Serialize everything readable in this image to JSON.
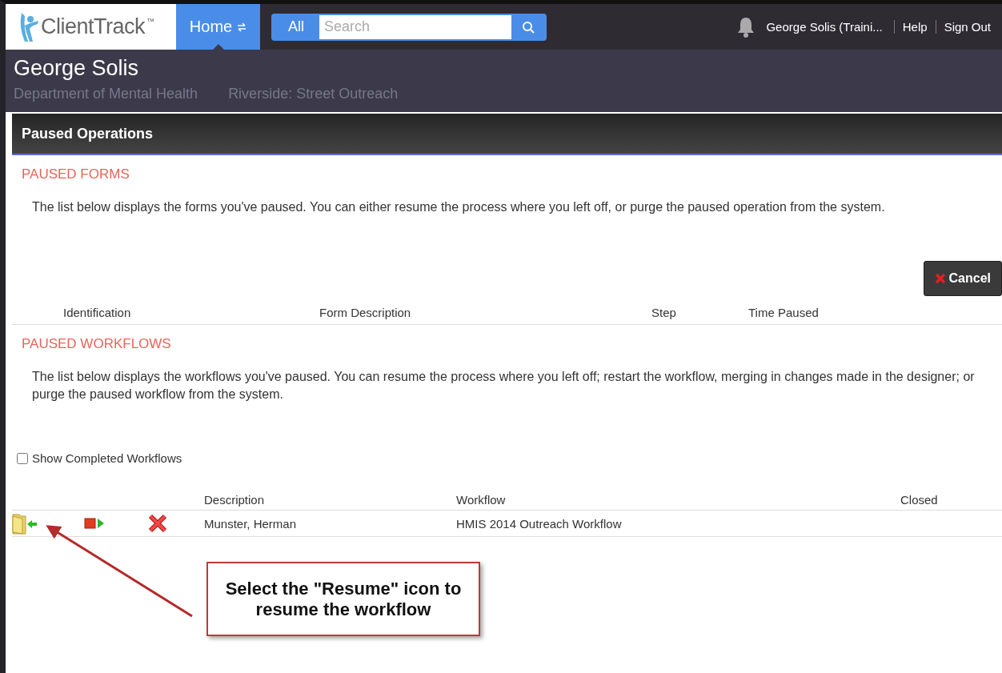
{
  "header": {
    "logo": {
      "name": "ClientTrack",
      "mark": "™"
    },
    "home_tab": {
      "label": "Home",
      "selected": true
    },
    "search": {
      "scope": "All",
      "placeholder": "Search"
    },
    "user": "George Solis (Traini...",
    "links": [
      "Help",
      "Sign Out"
    ]
  },
  "client": {
    "name": "George Solis",
    "department": "Department of Mental Health",
    "program": "Riverside: Street Outreach"
  },
  "panel_title": "Paused Operations",
  "paused_forms": {
    "heading": "PAUSED FORMS",
    "description": "The list below displays the forms you've paused. You can either resume the process where you left off, or purge the paused operation from the system.",
    "cancel_button": "Cancel",
    "columns": [
      "Identification",
      "Form Description",
      "Step",
      "Time Paused"
    ]
  },
  "paused_workflows": {
    "heading": "PAUSED WORKFLOWS",
    "description": "The list below displays the workflows you've paused. You can resume the process where you left off; restart the workflow, merging in changes made in the designer; or purge the paused workflow from the system.",
    "show_completed": {
      "label": "Show Completed Workflows",
      "checked": false
    },
    "columns": [
      "Description",
      "Workflow",
      "Closed"
    ],
    "rows": [
      {
        "description": "Munster, Herman",
        "workflow": "HMIS 2014 Outreach Workflow"
      }
    ]
  },
  "annotation": "Select the \"Resume\" icon to resume the workflow"
}
